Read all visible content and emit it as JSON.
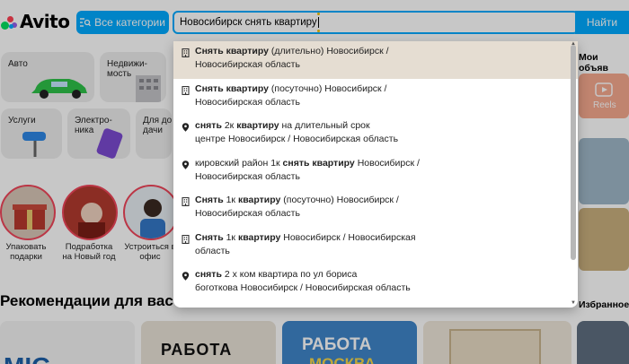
{
  "header": {
    "logo_text": "Avito",
    "categories_button": "Все категории",
    "search_value": "Новосибирск снять квартиру",
    "search_button": "Найти"
  },
  "tiles": [
    {
      "label": "Авто"
    },
    {
      "label": "Недвижи-мость"
    },
    {
      "label": "Услуги"
    },
    {
      "label": "Электро-ника"
    },
    {
      "label": "Для дома и дачи"
    }
  ],
  "stories": [
    {
      "label": "Упаковать подарки"
    },
    {
      "label": "Подработка на Новый год"
    },
    {
      "label": "Устроиться в офис"
    }
  ],
  "side": {
    "my_ads": "Мои объяв",
    "reels": "Reels",
    "favorites": "Избранное"
  },
  "recommendations_title": "Рекомендации для вас",
  "thumb_text": {
    "rabota1": "РАБОТА",
    "rabota2": "РАБОТА",
    "moskva": "МОСКВА"
  },
  "suggestions": [
    {
      "icon": "building-icon",
      "bold": "Снять квартиру",
      "rest": " (длительно) Новосибирск /",
      "line2": "Новосибирская область",
      "active": true
    },
    {
      "icon": "building-icon",
      "bold": "Снять квартиру",
      "rest": " (посуточно) Новосибирск /",
      "line2": "Новосибирская область",
      "active": false
    },
    {
      "icon": "pin-icon",
      "parts": [
        [
          "снять",
          true
        ],
        [
          " 2к ",
          false
        ],
        [
          "квартиру",
          true
        ],
        [
          " на длительный срок",
          false
        ]
      ],
      "line2": "центре Новосибирск / Новосибирская область",
      "active": false
    },
    {
      "icon": "pin-icon",
      "parts": [
        [
          "кировский район 1к ",
          false
        ],
        [
          "снять квартиру",
          true
        ],
        [
          " Новосибирск /",
          false
        ]
      ],
      "line2": "Новосибирская область",
      "active": false
    },
    {
      "icon": "building-icon",
      "parts": [
        [
          "Снять",
          true
        ],
        [
          " 1к ",
          false
        ],
        [
          "квартиру",
          true
        ],
        [
          " (посуточно) Новосибирск /",
          false
        ]
      ],
      "line2": "Новосибирская область",
      "active": false
    },
    {
      "icon": "building-icon",
      "parts": [
        [
          "Снять",
          true
        ],
        [
          " 1к ",
          false
        ],
        [
          "квартиру",
          true
        ],
        [
          " Новосибирск / Новосибирская",
          false
        ]
      ],
      "line2": "область",
      "active": false
    },
    {
      "icon": "pin-icon",
      "parts": [
        [
          "снять",
          true
        ],
        [
          " 2 х ком квартира по ул бориса",
          false
        ]
      ],
      "line2": "боготкова Новосибирск / Новосибирская область",
      "active": false
    }
  ],
  "colors": {
    "accent": "#00aaff",
    "active_row": "#e5ddd2"
  }
}
